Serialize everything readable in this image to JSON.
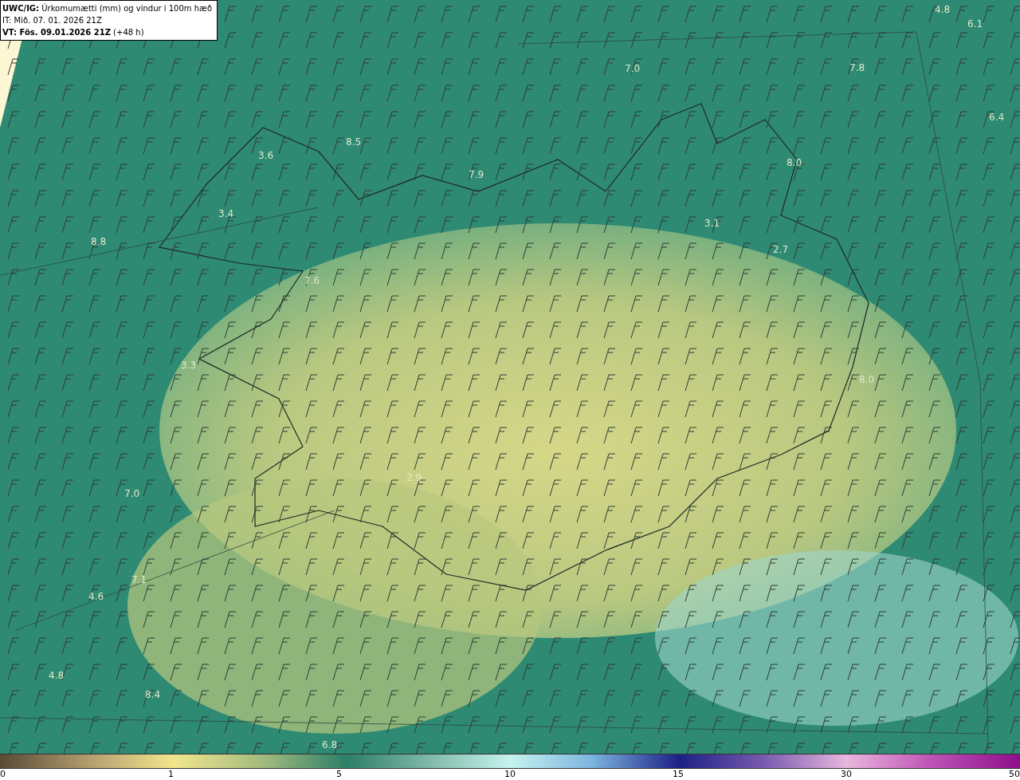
{
  "header": {
    "lines": [
      "**UWC/IG:** Úrkomumætti (mm) og vindur i 100m hæð",
      "IT: Mið. 07. 01. 2026 21Z",
      "**VT: Fös. 09.01.2026 21Z** (+48 h)"
    ]
  },
  "map": {
    "value_labels": [
      "4.8",
      "6.1",
      "7.0",
      "7.8",
      "6.4",
      "3.6",
      "8.5",
      "3.4",
      "7.9",
      "8.0",
      "8.8",
      "3.1",
      "2.7",
      "7.6",
      "3.3",
      "8.0",
      "2.9",
      "7.0",
      "7.1",
      "4.6",
      "4.8",
      "8.4",
      "6.8"
    ]
  },
  "colorbar": {
    "ticks": [
      "0",
      "1",
      "5",
      "10",
      "15",
      "30",
      "50"
    ]
  }
}
